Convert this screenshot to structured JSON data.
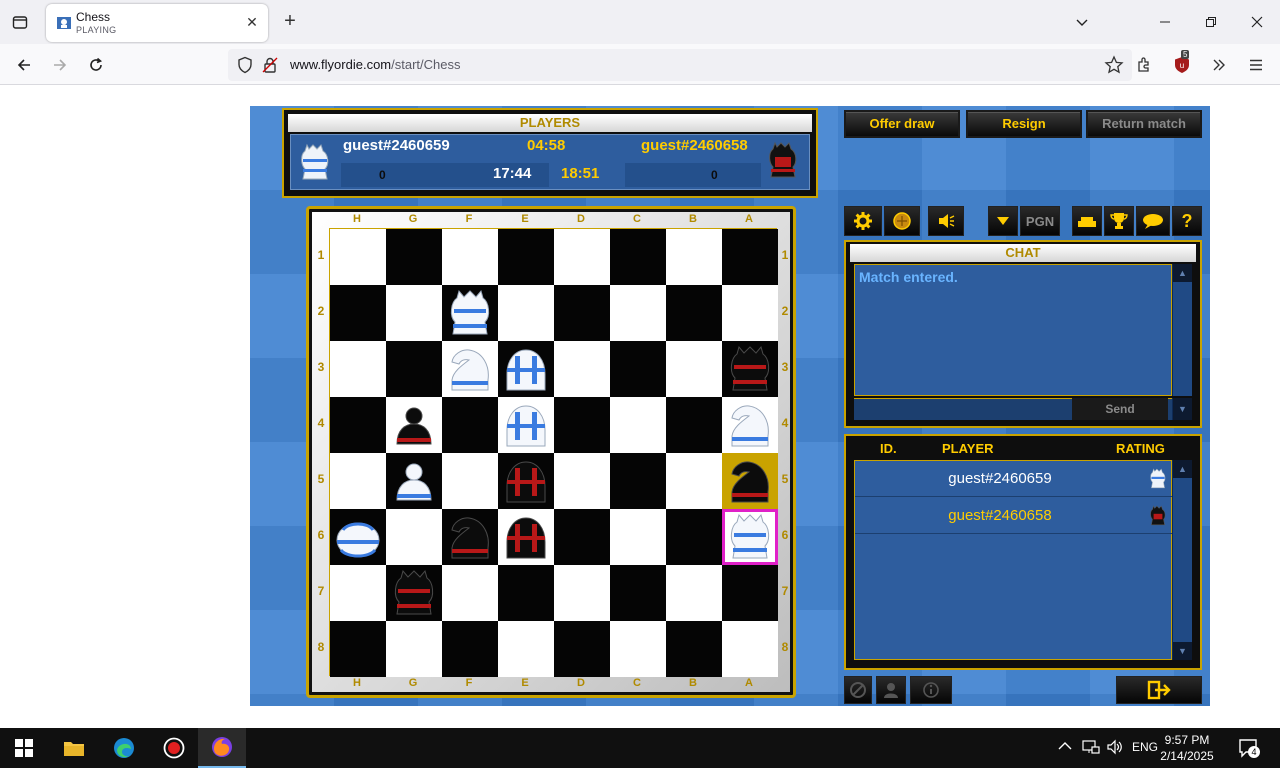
{
  "browser": {
    "tab_title": "Chess",
    "tab_subtitle": "PLAYING",
    "url_host": "www.flyordie.com",
    "url_path": "/start/Chess",
    "extension_badge": "5"
  },
  "game": {
    "players_header": "PLAYERS",
    "white_player": "guest#2460659",
    "black_player": "guest#2460658",
    "white_move_time": "04:58",
    "white_total_time": "17:44",
    "black_total_time": "18:51",
    "white_score": "0",
    "black_score": "0",
    "files": [
      "H",
      "G",
      "F",
      "E",
      "D",
      "C",
      "B",
      "A"
    ],
    "ranks": [
      "1",
      "2",
      "3",
      "4",
      "5",
      "6",
      "7",
      "8"
    ],
    "pieces": [
      {
        "square": "F2",
        "color": "white",
        "type": "rook"
      },
      {
        "square": "F3",
        "color": "white",
        "type": "knight"
      },
      {
        "square": "E3",
        "color": "white",
        "type": "bishop"
      },
      {
        "square": "A3",
        "color": "black",
        "type": "rook"
      },
      {
        "square": "G4",
        "color": "black",
        "type": "pawn"
      },
      {
        "square": "E4",
        "color": "white",
        "type": "bishop"
      },
      {
        "square": "A4",
        "color": "white",
        "type": "knight"
      },
      {
        "square": "G5",
        "color": "white",
        "type": "pawn"
      },
      {
        "square": "E5",
        "color": "black",
        "type": "bishop"
      },
      {
        "square": "A5",
        "color": "black",
        "type": "knight"
      },
      {
        "square": "H6",
        "color": "white",
        "type": "king"
      },
      {
        "square": "F6",
        "color": "black",
        "type": "knight"
      },
      {
        "square": "E6",
        "color": "black",
        "type": "bishop"
      },
      {
        "square": "A6",
        "color": "white",
        "type": "rook"
      },
      {
        "square": "G7",
        "color": "black",
        "type": "rook"
      }
    ],
    "last_move_square": "A5",
    "selected_square": "A6",
    "buttons": {
      "offer_draw": "Offer draw",
      "resign": "Resign",
      "return_match": "Return match",
      "pgn": "PGN"
    },
    "chat": {
      "header": "CHAT",
      "messages": [
        "Match entered."
      ],
      "send_label": "Send"
    },
    "player_list": {
      "col_id": "ID.",
      "col_player": "PLAYER",
      "col_rating": "RATING",
      "rows": [
        {
          "name": "guest#2460659",
          "color": "white"
        },
        {
          "name": "guest#2460658",
          "color": "black"
        }
      ]
    },
    "colors": {
      "gold": "#ffcc00",
      "panel_blue": "#2e5d9e",
      "background_blue": "#3c7fd0",
      "selection": "#e020c8"
    }
  },
  "taskbar": {
    "language": "ENG",
    "time": "9:57 PM",
    "date": "2/14/2025",
    "notification_count": "4"
  }
}
